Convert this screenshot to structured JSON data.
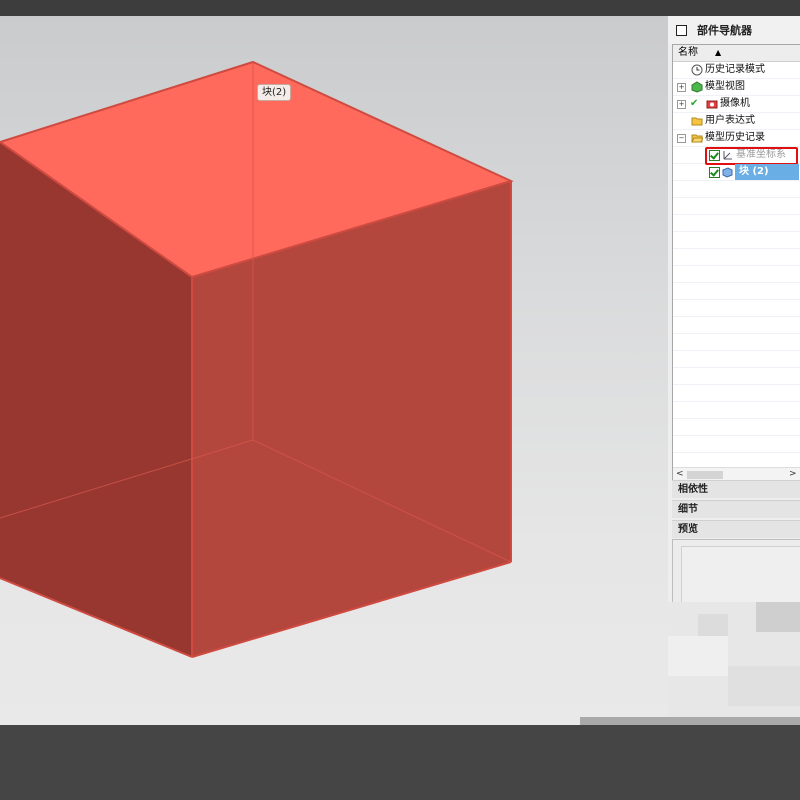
{
  "viewport": {
    "feature_tag": "块(2)",
    "cube_colors": {
      "top": "#ff6a5c",
      "left": "#973730",
      "right": "#b4473d",
      "edge": "#cf4a40"
    }
  },
  "navigator": {
    "title": "部件导航器",
    "column_header": "名称",
    "sort_icon": "triangle-up-icon",
    "items": [
      {
        "label": "历史记录模式",
        "icon": "clock-icon"
      },
      {
        "label": "模型视图",
        "icon": "model-view-icon"
      },
      {
        "label": "摄像机",
        "icon": "camera-icon"
      },
      {
        "label": "用户表达式",
        "icon": "folder-icon"
      },
      {
        "label": "模型历史记录",
        "icon": "folder-open-icon"
      },
      {
        "label": "基准坐标系",
        "icon": "datum-csys-icon"
      },
      {
        "label": "块 (2)",
        "icon": "block-icon"
      }
    ],
    "scroll_left": "<",
    "scroll_right": ">"
  },
  "panels": {
    "dependencies": "相依性",
    "details": "细节",
    "preview": "预览"
  }
}
